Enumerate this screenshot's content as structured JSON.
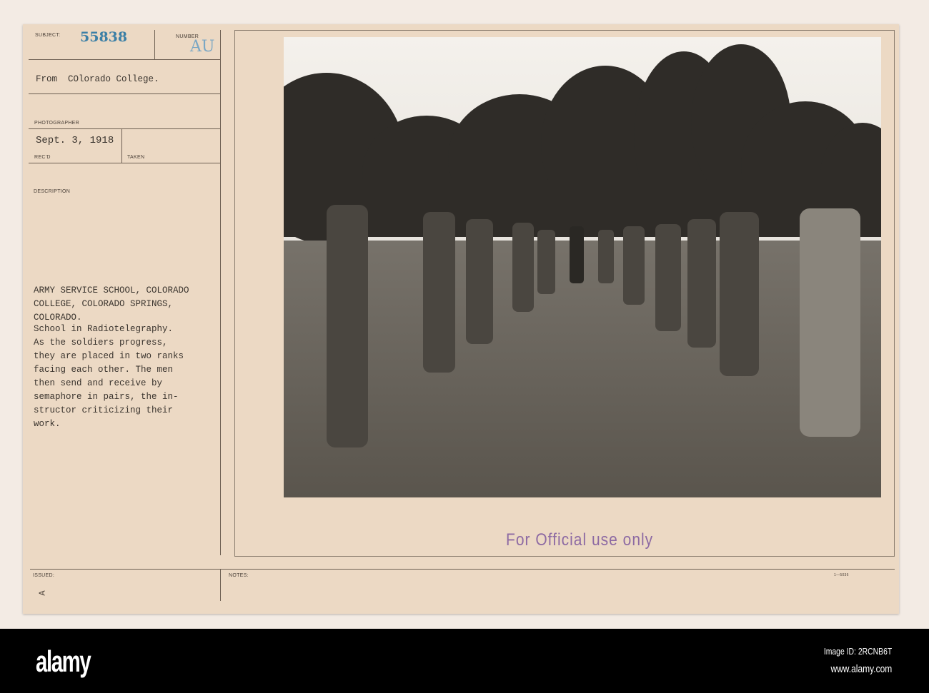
{
  "card": {
    "subject_label": "SUBJECT:",
    "subject_number": "55838",
    "number_label": "NUMBER",
    "number_value": "AU",
    "from_line": "From  COlorado College.",
    "photographer_label": "PHOTOGRAPHER",
    "date": "Sept. 3, 1918",
    "recd_label": "REC'D",
    "taken_label": "TAKEN",
    "description_label": "DESCRIPTION",
    "title": "ARMY SERVICE SCHOOL, COLORADO\nCOLLEGE, COLORADO SPRINGS,\nCOLORADO.",
    "description": "School in Radiotelegraphy.\nAs the soldiers progress,\nthey are placed in two ranks\nfacing each other. The men\nthen send and receive by\nsemaphore in pairs, the in-\nstructor criticizing their\nwork.",
    "issued_label": "ISSUED:",
    "issued_mark": "A",
    "notes_label": "NOTES:",
    "form_number": "1—5036",
    "stamp": "For Official use only"
  },
  "photo": {
    "caption_hidden": ""
  },
  "footer": {
    "logo": "alamy",
    "image_id": "Image ID: 2RCNB6T",
    "url": "www.alamy.com"
  },
  "colors": {
    "card": "#ecd9c4",
    "stamp": "#8d6aa3",
    "number_blue": "#3b7fa6"
  }
}
